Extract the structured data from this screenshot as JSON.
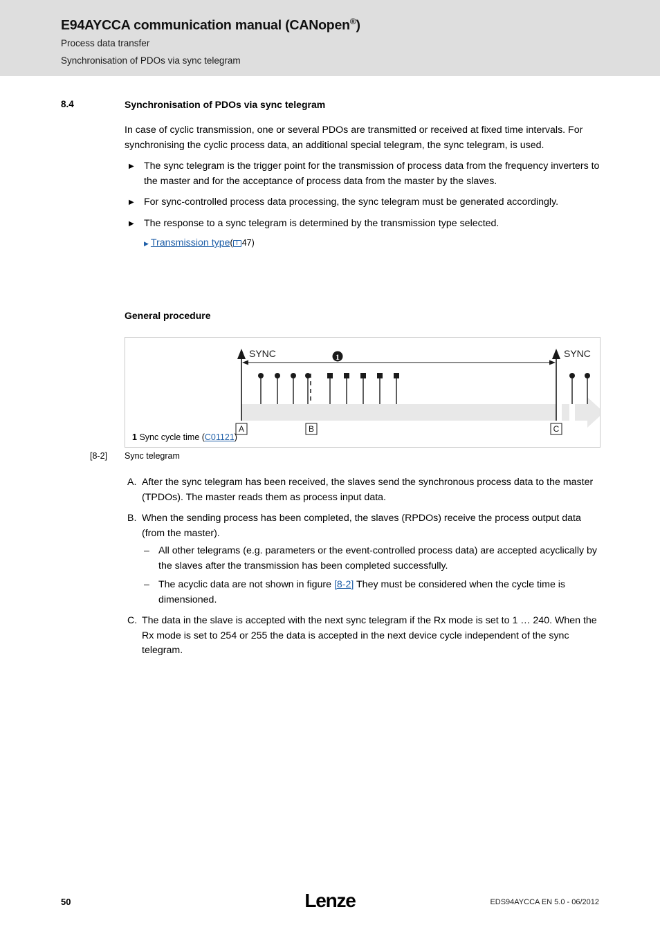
{
  "header": {
    "title_main": "E94AYCCA communication manual (CANopen",
    "title_reg": "®",
    "title_tail": ")",
    "subtitle1": "Process data transfer",
    "subtitle2": "Synchronisation of PDOs via sync telegram",
    "band_color": "#dedede"
  },
  "section": {
    "number": "8.4",
    "title": "Synchronisation of PDOs via sync telegram"
  },
  "intro": {
    "paragraph": "In case of cyclic transmission, one or several PDOs are transmitted or received at fixed time intervals. For synchronising the cyclic process data, an additional special telegram, the sync telegram, is used."
  },
  "bullets": [
    "The sync telegram is the trigger point for the transmission of process data from the frequency inverters to the master and for the acceptance of process data from the master by the slaves.",
    "For sync-controlled process data processing, the sync telegram must be generated accordingly.",
    "The response to a sync telegram is determined by the transmission type selected."
  ],
  "cross_reference": {
    "link_text": "Transmission type",
    "page_ref": "47",
    "open_paren": "(",
    "close_paren": ")",
    "link_color": "#1f5fa8"
  },
  "general_procedure": {
    "heading": "General procedure"
  },
  "figure": {
    "sync_left_label": "SYNC",
    "sync_right_label": "SYNC",
    "callout_number": "1",
    "marker_a": "A",
    "marker_b": "B",
    "marker_c": "C",
    "legend_number": "1",
    "legend_text": "Sync cycle time (",
    "legend_link": "C01121",
    "legend_close": ")",
    "caption_number": "[8-2]",
    "caption_text": "Sync telegram",
    "bar_color": "#e8e8e8",
    "line_color": "#1a1a1a"
  },
  "procedure_items": [
    {
      "marker": "A.",
      "text": "After the sync telegram has been received, the slaves send the synchronous process data to the master (TPDOs). The master reads them as process input data.",
      "subitems": []
    },
    {
      "marker": "B.",
      "text": "When the sending process has been completed, the slaves (RPDOs) receive the process output data (from the master).",
      "subitems": [
        {
          "pre": "All other telegrams (e.g. parameters or the event-controlled process data) are accepted acyclically by the slaves after the transmission has been completed successfully.",
          "link": "",
          "post": ""
        },
        {
          "pre": "The acyclic data are not shown in figure ",
          "link": "[8-2]",
          "post": " They must be considered when the cycle time is dimensioned."
        }
      ]
    },
    {
      "marker": "C.",
      "text": "The data in the slave is accepted with the next sync telegram if the Rx mode is set to 1 … 240. When the Rx mode is set to 254 or 255 the data is accepted in the next device cycle independent of the sync telegram.",
      "subitems": []
    }
  ],
  "footer": {
    "page_number": "50",
    "logo_text": "Lenze",
    "doc_id": "EDS94AYCCA EN 5.0 - 06/2012"
  }
}
